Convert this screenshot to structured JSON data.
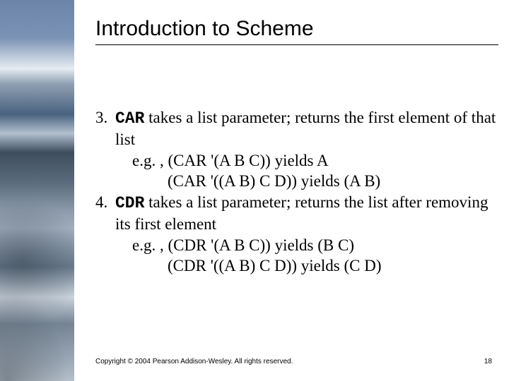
{
  "title": "Introduction to Scheme",
  "items": [
    {
      "num": "3.",
      "keyword": "CAR",
      "desc_after": " takes a list parameter; returns the first element of that list",
      "example_intro": "e.g. , ",
      "example1": "(CAR '(A B C)) yields A",
      "example2": "(CAR '((A B) C D)) yields (A B)"
    },
    {
      "num": "4.",
      "keyword": "CDR",
      "desc_after": " takes a list parameter; returns the list after removing its first element",
      "example_intro": "e.g. , ",
      "example1": "(CDR '(A B C)) yields (B C)",
      "example2": "(CDR '((A B) C D)) yields (C D)"
    }
  ],
  "footer": {
    "copyright": "Copyright © 2004 Pearson Addison-Wesley. All rights reserved.",
    "page": "18"
  }
}
